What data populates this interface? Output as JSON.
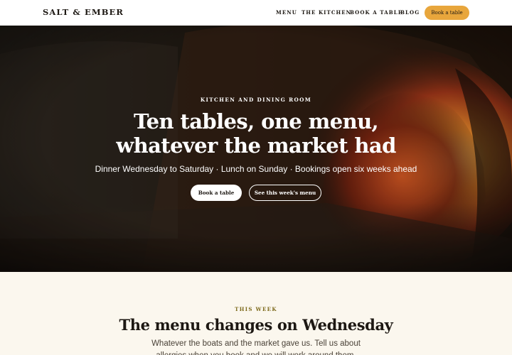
{
  "header": {
    "logo": "SALT & EMBER",
    "nav": [
      "MENU",
      "THE KITCHEN",
      "BOOK A TABLE",
      "BLOG"
    ],
    "cta_label": "Book a table"
  },
  "hero": {
    "eyebrow": "KITCHEN AND DINING ROOM",
    "title": "Ten tables, one menu, whatever the market had",
    "subtitle": "Dinner Wednesday to Saturday · Lunch on Sunday · Bookings open six weeks ahead",
    "primary_button": "Book a table",
    "secondary_button": "See this week's menu"
  },
  "this_week": {
    "eyebrow": "THIS WEEK",
    "title": "The menu changes on Wednesday",
    "body": "Whatever the boats and the market gave us. Tell us about allergies when you book and we will work around them."
  },
  "colors": {
    "accent": "#e8a63c",
    "eyebrow_olive": "#7d6a1c",
    "section_bg": "#fbf7ee",
    "text_dark": "#1d1813"
  }
}
